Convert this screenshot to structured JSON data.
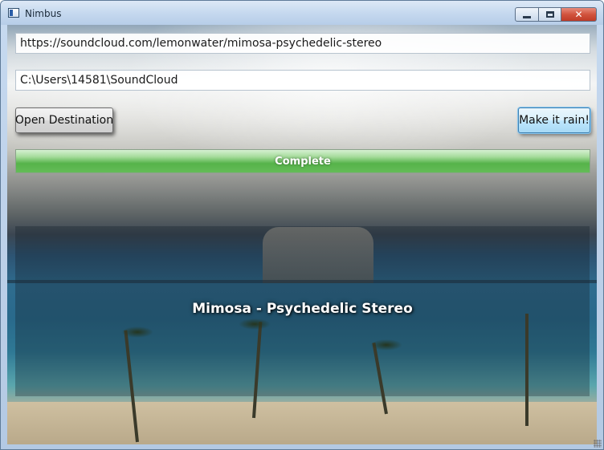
{
  "window": {
    "title": "Nimbus",
    "icon": "app-window-icon",
    "controls": {
      "minimize_icon": "minimize-icon",
      "maximize_icon": "maximize-icon",
      "close_glyph": "✕"
    }
  },
  "form": {
    "url_value": "https://soundcloud.com/lemonwater/mimosa-psychedelic-stereo",
    "destination_value": "C:\\Users\\14581\\SoundCloud",
    "open_destination_label": "Open Destination",
    "make_it_rain_label": "Make it rain!"
  },
  "progress": {
    "value_percent": 100,
    "label": "Complete",
    "color": "#56b34a"
  },
  "track": {
    "title": "Mimosa - Psychedelic Stereo"
  }
}
